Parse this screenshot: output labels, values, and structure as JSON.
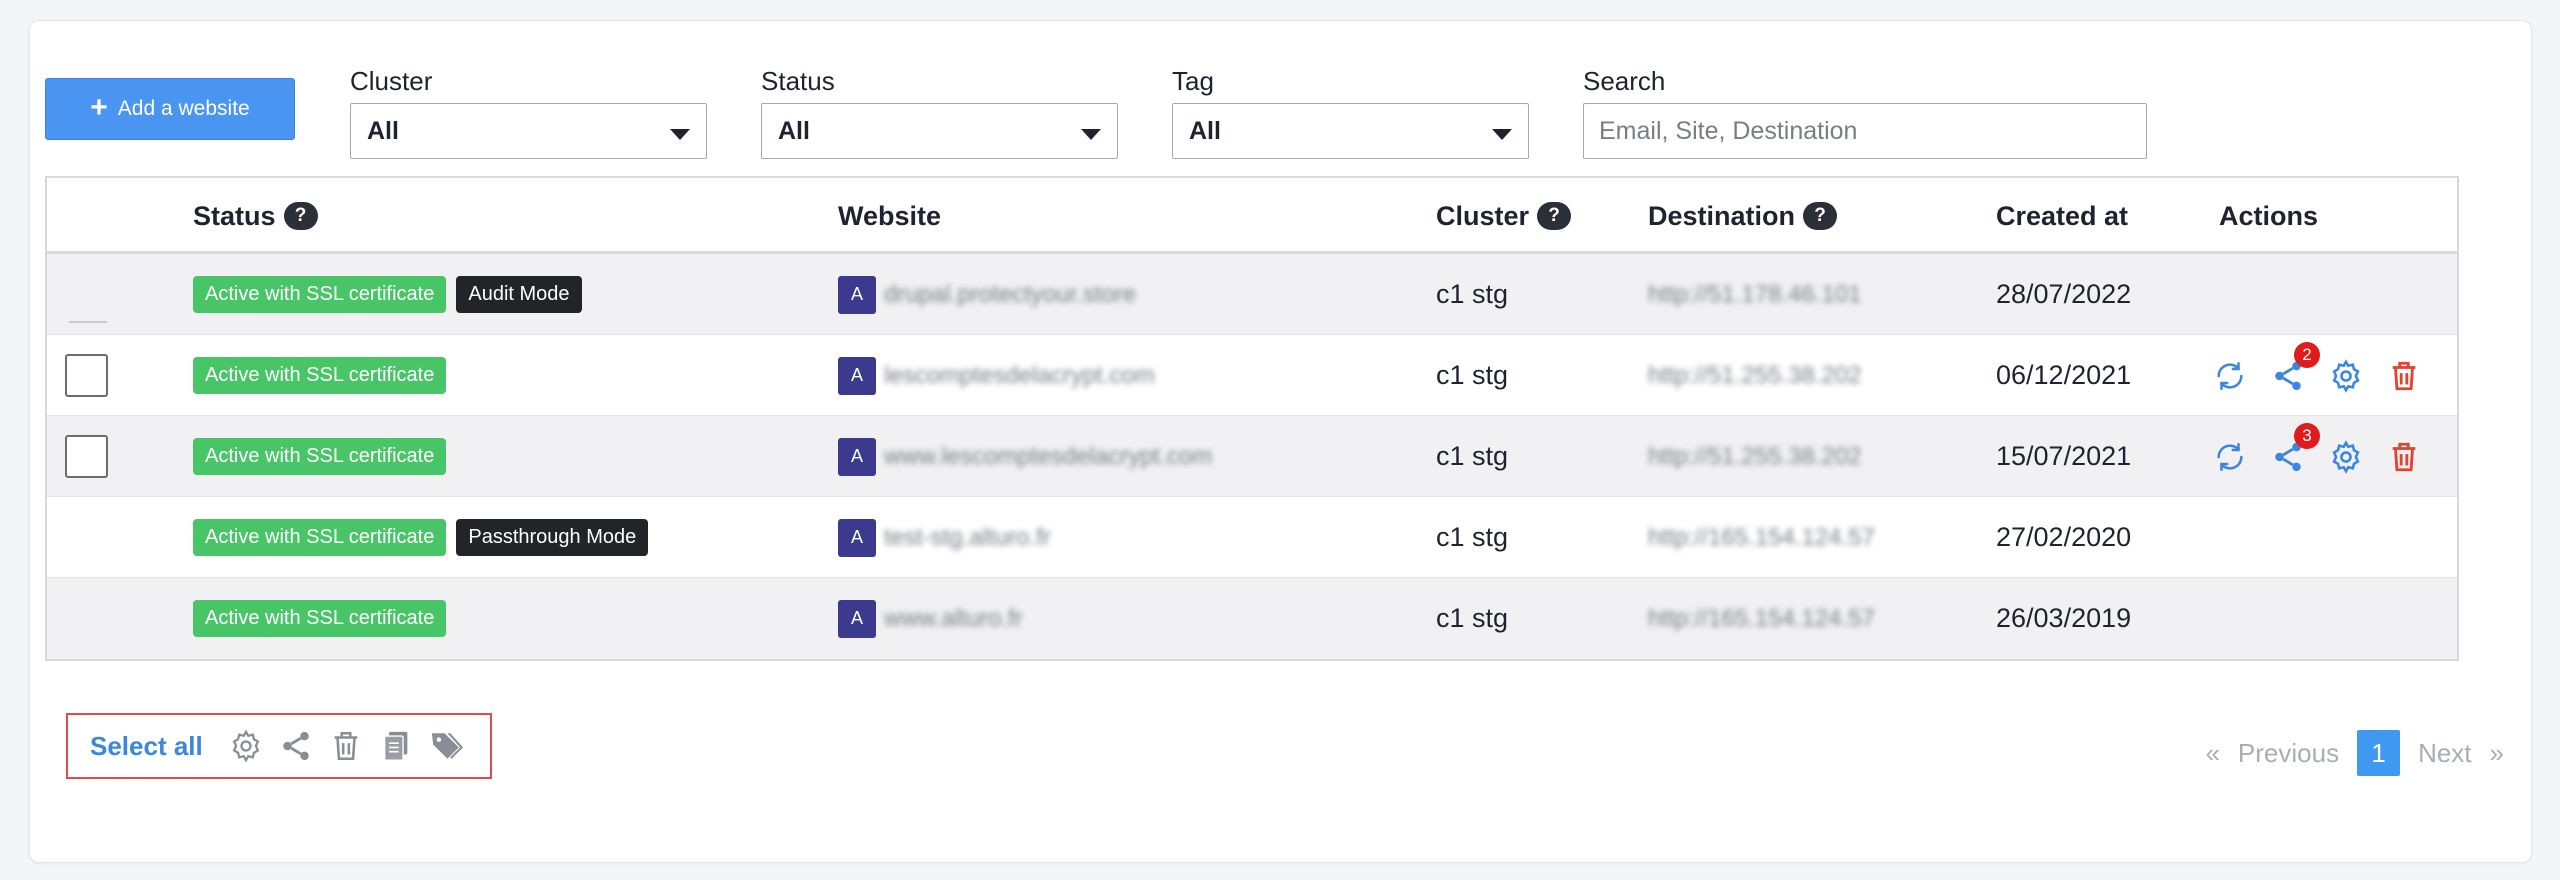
{
  "toolbar": {
    "add_label": "Add a website",
    "cluster_label": "Cluster",
    "cluster_value": "All",
    "status_label": "Status",
    "status_value": "All",
    "tag_label": "Tag",
    "tag_value": "All",
    "search_label": "Search",
    "search_placeholder": "Email, Site, Destination"
  },
  "table": {
    "headers": {
      "status": "Status",
      "website": "Website",
      "cluster": "Cluster",
      "destination": "Destination",
      "created": "Created at",
      "actions": "Actions"
    },
    "help_glyph": "?",
    "rows": [
      {
        "status": "Active with SSL certificate",
        "mode": "Audit Mode",
        "avatar": "A",
        "website": "drupal.protectyour.store",
        "cluster": "c1 stg",
        "destination": "http://51.178.46.101",
        "created": "28/07/2022"
      },
      {
        "status": "Active with SSL certificate",
        "mode": "",
        "avatar": "A",
        "website": "lescomptesdelacrypt.com",
        "cluster": "c1 stg",
        "destination": "http://51.255.38.202",
        "created": "06/12/2021",
        "share_count": "2"
      },
      {
        "status": "Active with SSL certificate",
        "mode": "",
        "avatar": "A",
        "website": "www.lescomptesdelacrypt.com",
        "cluster": "c1 stg",
        "destination": "http://51.255.38.202",
        "created": "15/07/2021",
        "share_count": "3"
      },
      {
        "status": "Active with SSL certificate",
        "mode": "Passthrough Mode",
        "avatar": "A",
        "website": "test-stg.alturo.fr",
        "cluster": "c1 stg",
        "destination": "http://165.154.124.57",
        "created": "27/02/2020"
      },
      {
        "status": "Active with SSL certificate",
        "mode": "",
        "avatar": "A",
        "website": "www.alturo.fr",
        "cluster": "c1 stg",
        "destination": "http://165.154.124.57",
        "created": "26/03/2019"
      }
    ]
  },
  "bulk": {
    "select_all": "Select all",
    "icons": [
      "gear-icon",
      "share-icon",
      "trash-icon",
      "copy-icon",
      "tag-icon"
    ]
  },
  "pagination": {
    "prev_arrow": "«",
    "prev": "Previous",
    "current": "1",
    "next": "Next",
    "next_arrow": "»"
  },
  "colors": {
    "primary": "#4a95f2",
    "ssl_badge": "#48c567",
    "mode_badge": "#222428",
    "danger": "#e0432f",
    "avatar": "#3b3a8f"
  }
}
